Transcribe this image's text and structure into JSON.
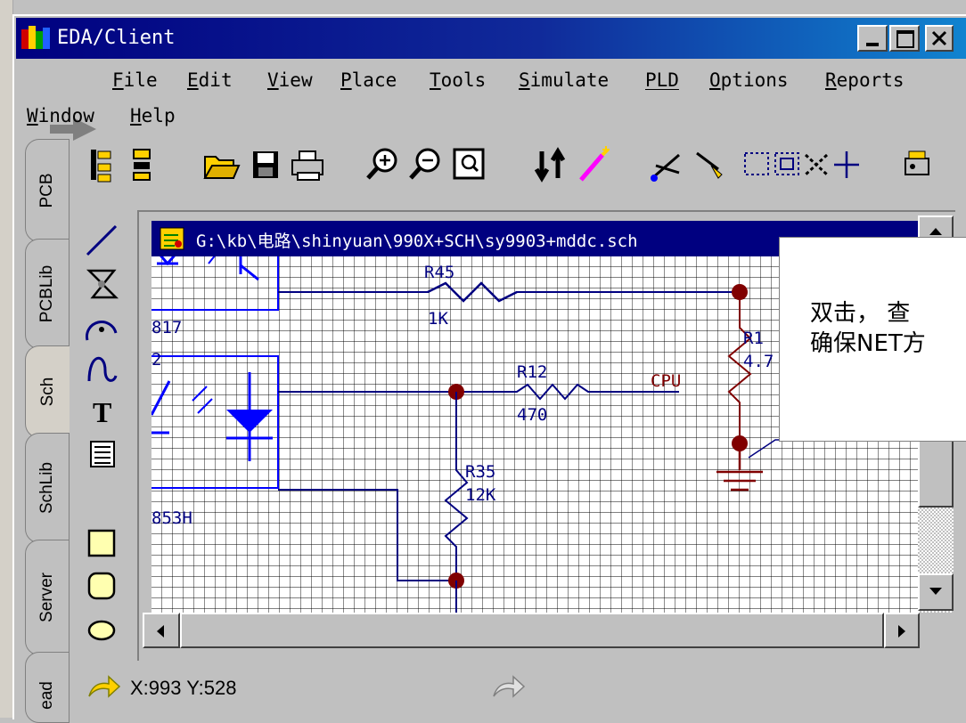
{
  "window": {
    "title": "EDA/Client"
  },
  "menu": {
    "row1": [
      {
        "key": "F",
        "rest": "ile"
      },
      {
        "key": "E",
        "rest": "dit"
      },
      {
        "key": "V",
        "rest": "iew"
      },
      {
        "key": "P",
        "rest": "lace"
      },
      {
        "key": "T",
        "rest": "ools"
      },
      {
        "key": "S",
        "rest": "imulate"
      },
      {
        "key": "PLD",
        "rest": ""
      },
      {
        "key": "O",
        "rest": "ptions"
      },
      {
        "key": "R",
        "rest": "eports"
      }
    ],
    "row2": [
      {
        "key": "W",
        "rest": "indow"
      },
      {
        "key": "H",
        "rest": "elp"
      }
    ]
  },
  "panel_tabs": [
    "PCB",
    "PCBLib",
    "Sch",
    "SchLib",
    "Server",
    "ead"
  ],
  "document": {
    "title": "G:\\kb\\电路\\shinyuan\\990X+SCH\\sy9903+mddc.sch"
  },
  "schematic": {
    "labels": {
      "r45": "R45",
      "r45_val": "1K",
      "r12": "R12",
      "r12_val": "470",
      "r35": "R35",
      "r35_val": "12K",
      "r1_partial": "R1",
      "r1_val_partial": "4.7",
      "cpu": "CPU",
      "opto1": "817",
      "opto2_ref": "2",
      "opto2": "853H"
    },
    "colors": {
      "grid_line": "#000000",
      "grid_bg": "#ffffff",
      "wire": "#000080",
      "component": "#800000",
      "junction": "#800000",
      "text": "#000080",
      "net_label": "#800000",
      "part_blue": "#0000ff"
    }
  },
  "callout": {
    "line1": "双击， 查",
    "line2": "确保NET方"
  },
  "status": {
    "coords": "X:993 Y:528"
  }
}
